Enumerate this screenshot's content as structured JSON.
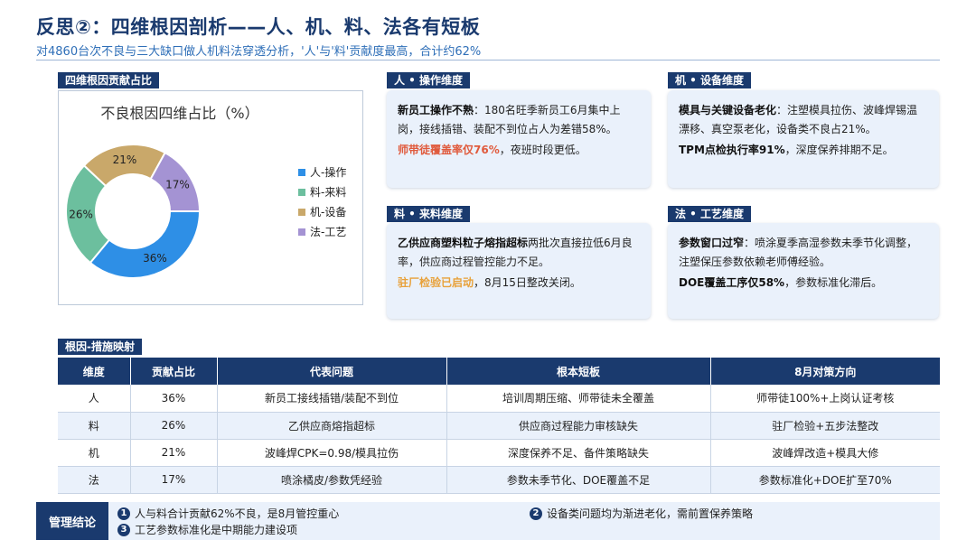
{
  "header": {
    "title": "反思②：四维根因剖析——人、机、料、法各有短板",
    "subtitle": "对4860台次不良与三大缺口做人机料法穿透分析，'人'与'料'贡献度最高，合计约62%"
  },
  "chart_section": {
    "tag": "四维根因贡献占比"
  },
  "chart_data": {
    "type": "pie",
    "title": "不良根因四维占比（%）",
    "categories": [
      "人-操作",
      "料-来料",
      "机-设备",
      "法-工艺"
    ],
    "values": [
      36,
      26,
      21,
      17
    ],
    "labels": [
      "36%",
      "26%",
      "21%",
      "17%"
    ],
    "colors": [
      "#2e8fe6",
      "#6cbf9e",
      "#c9a86a",
      "#a493d3"
    ],
    "legend": "right",
    "donut": true
  },
  "cards": {
    "person": {
      "tag": "人 • 操作维度",
      "p1_bold": "新员工操作不熟",
      "p1_rest": "：180名旺季新员工6月集中上岗，接线插错、装配不到位占人为差错58%。",
      "p2_hl": "师带徒覆盖率仅76%",
      "p2_rest": "，夜班时段更低。"
    },
    "machine": {
      "tag": "机 • 设备维度",
      "p1_bold": "模具与关键设备老化",
      "p1_rest": "：注塑模具拉伤、波峰焊锡温漂移、真空泵老化，设备类不良占21%。",
      "p2_bold": "TPM点检执行率91%",
      "p2_rest": "，深度保养排期不足。"
    },
    "material": {
      "tag": "料 • 来料维度",
      "p1_bold": "乙供应商塑料粒子熔指超标",
      "p1_rest": "两批次直接拉低6月良率，供应商过程管控能力不足。",
      "p2_hl": "驻厂检验已启动",
      "p2_rest": "，8月15日整改关闭。"
    },
    "method": {
      "tag": "法 • 工艺维度",
      "p1_bold": "参数窗口过窄",
      "p1_rest": "：喷涂夏季高湿参数未季节化调整，注塑保压参数依赖老师傅经验。",
      "p2_bold": "DOE覆盖工序仅58%",
      "p2_rest": "，参数标准化滞后。"
    }
  },
  "table": {
    "tag": "根因-措施映射",
    "headers": [
      "维度",
      "贡献占比",
      "代表问题",
      "根本短板",
      "8月对策方向"
    ],
    "rows": [
      [
        "人",
        "36%",
        "新员工接线插错/装配不到位",
        "培训周期压缩、师带徒未全覆盖",
        "师带徒100%+上岗认证考核"
      ],
      [
        "料",
        "26%",
        "乙供应商熔指超标",
        "供应商过程能力审核缺失",
        "驻厂检验+五步法整改"
      ],
      [
        "机",
        "21%",
        "波峰焊CPK=0.98/模具拉伤",
        "深度保养不足、备件策略缺失",
        "波峰焊改造+模具大修"
      ],
      [
        "法",
        "17%",
        "喷涂橘皮/参数凭经验",
        "参数未季节化、DOE覆盖不足",
        "参数标准化+DOE扩至70%"
      ]
    ]
  },
  "conclusion": {
    "tag": "管理结论",
    "items": [
      {
        "num": "1",
        "text": "人与料合计贡献62%不良，是8月管控重心"
      },
      {
        "num": "2",
        "text": "设备类问题均为渐进老化，需前置保养策略"
      },
      {
        "num": "3",
        "text": "工艺参数标准化是中期能力建设项"
      }
    ]
  }
}
